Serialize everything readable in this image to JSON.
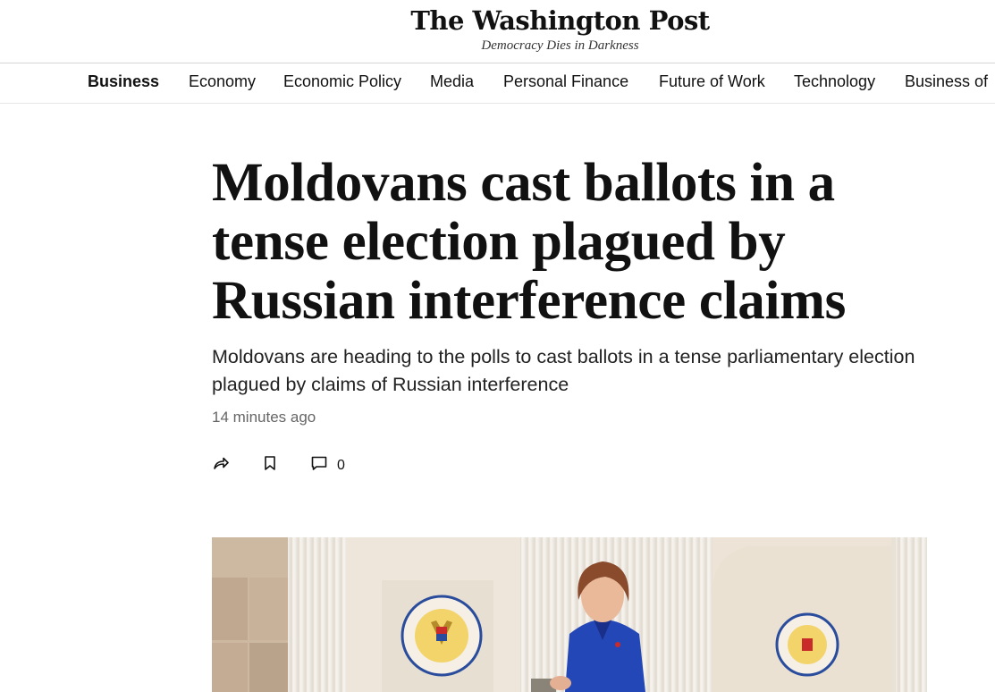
{
  "masthead": {
    "logo_text": "The Washington Post",
    "tagline": "Democracy Dies in Darkness"
  },
  "nav": {
    "items": [
      {
        "label": "Business",
        "active": true
      },
      {
        "label": "Economy"
      },
      {
        "label": "Economic Policy"
      },
      {
        "label": "Media"
      },
      {
        "label": "Personal Finance"
      },
      {
        "label": "Future of Work"
      },
      {
        "label": "Technology"
      },
      {
        "label": "Business of"
      }
    ]
  },
  "article": {
    "headline": "Moldovans cast ballots in a tense election plagued by Russian interference claims",
    "dek": "Moldovans are heading to the polls to cast ballots in a tense parliamentary election plagued by claims of Russian interference",
    "timestamp": "14 minutes ago",
    "comment_count": "0"
  },
  "icons": {
    "share": "share-arrow-icon",
    "bookmark": "bookmark-icon",
    "comment": "comment-bubble-icon"
  },
  "colors": {
    "text": "#111111",
    "muted": "#666666",
    "jacket": "#2447b8"
  }
}
